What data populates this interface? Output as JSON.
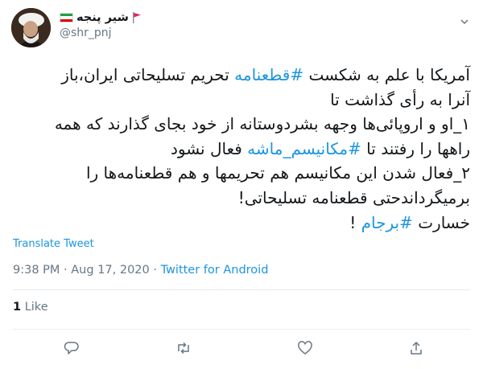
{
  "author": {
    "display_name": "شیر پنجه",
    "handle": "@shr_pnj",
    "flag_emoji": "iran-flag-icon",
    "trailing_emoji": "red-flag-icon"
  },
  "tweet": {
    "lines": [
      [
        {
          "t": "آمریکا با علم به شکست ",
          "h": false
        },
        {
          "t": "#قطعنامه",
          "h": true
        },
        {
          "t": " تحریم تسلیحاتی ایران،باز",
          "h": false
        }
      ],
      [
        {
          "t": "آنرا به رأی گذاشت تا",
          "h": false
        }
      ],
      [
        {
          "t": "۱_او و اروپائی‌ها وجهه بشردوستانه از خود بجای گذارند که همه",
          "h": false
        }
      ],
      [
        {
          "t": "راهها را رفتند تا ",
          "h": false
        },
        {
          "t": "#مکانیسم_ماشه",
          "h": true
        },
        {
          "t": " فعال نشود",
          "h": false
        }
      ],
      [
        {
          "t": "۲_فعال شدن این مکانیسم هم تحریمها و هم قطعنامه‌ها را",
          "h": false
        }
      ],
      [
        {
          "t": "برمیگرداندحتی قطعنامه تسلیحاتی!",
          "h": false
        }
      ],
      [
        {
          "t": "خسارت ",
          "h": false
        },
        {
          "t": "#برجام",
          "h": true
        },
        {
          "t": " !",
          "h": false
        }
      ]
    ]
  },
  "translate_label": "Translate Tweet",
  "meta": {
    "time": "9:38 PM",
    "sep1": " · ",
    "date": "Aug 17, 2020",
    "sep2": " · ",
    "source": "Twitter for Android"
  },
  "stats": {
    "likes_count": "1",
    "likes_label": "Like"
  },
  "colors": {
    "link": "#1b95e0",
    "muted": "#657786",
    "divider": "#e6ecf0"
  }
}
